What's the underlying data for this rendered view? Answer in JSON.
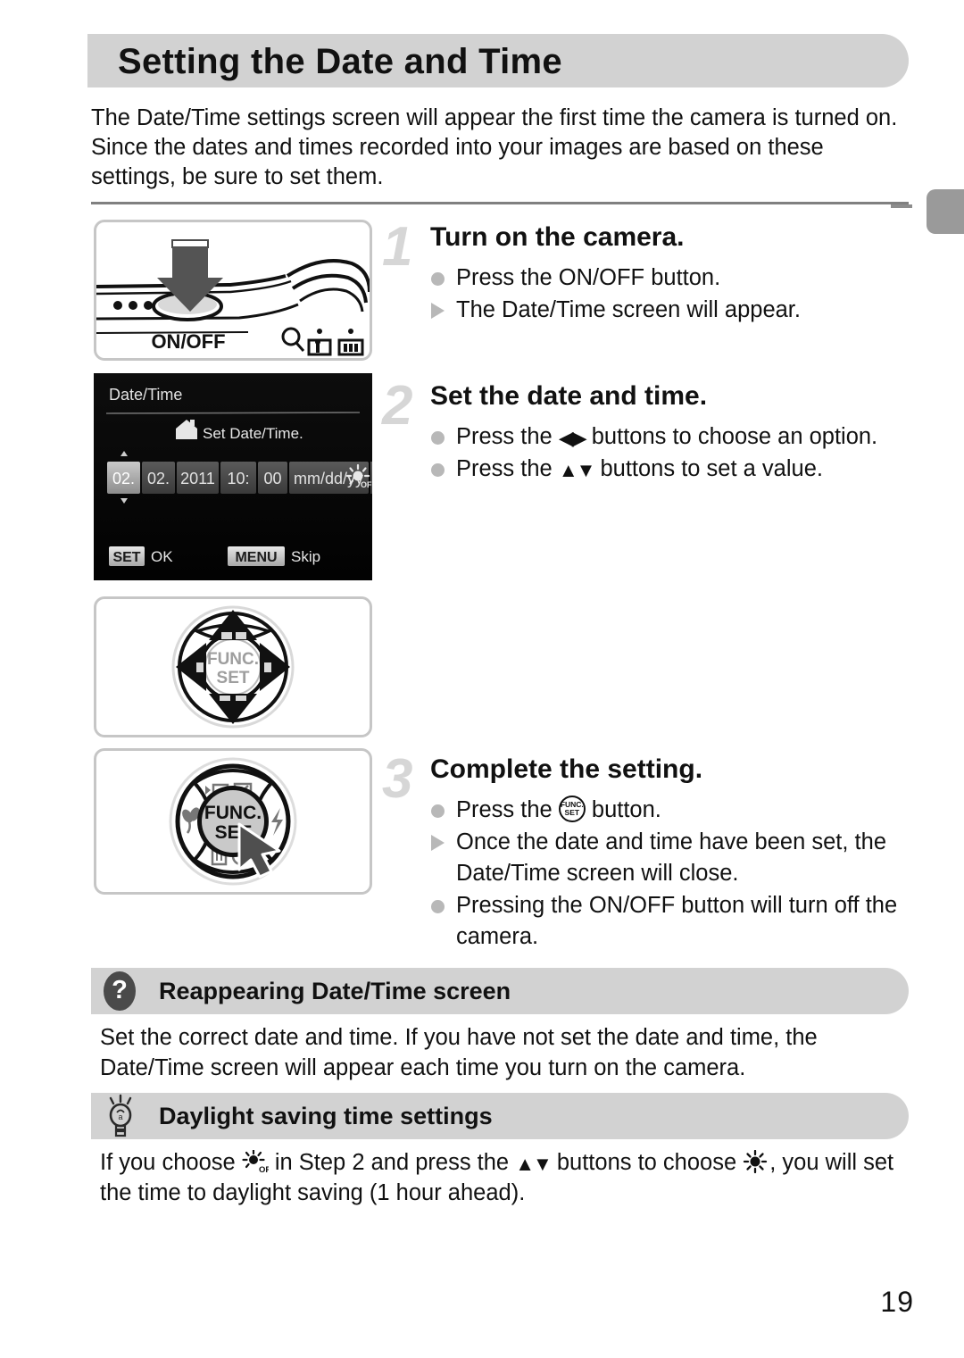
{
  "page": {
    "title": "Setting the Date and Time",
    "intro": "The Date/Time settings screen will appear the first time the camera is turned on. Since the dates and times recorded into your images are based on these settings, be sure to set them.",
    "page_number": "19",
    "banner_color": "#d2d2d2",
    "step_number_color": "#d6d6d6",
    "bullet_color": "#b8b8b8"
  },
  "steps": [
    {
      "number": "1",
      "heading": "Turn on the camera.",
      "lines": [
        {
          "marker": "dot",
          "text": "Press the ON/OFF button."
        },
        {
          "marker": "triangle",
          "text": "The Date/Time screen will appear."
        }
      ]
    },
    {
      "number": "2",
      "heading": "Set the date and time.",
      "lines": [
        {
          "marker": "dot",
          "pre": "Press the ",
          "glyph": "left-right-arrows",
          "post": " buttons to choose an option."
        },
        {
          "marker": "dot",
          "pre": "Press the ",
          "glyph": "up-down-arrows",
          "post": " buttons to set a value."
        }
      ]
    },
    {
      "number": "3",
      "heading": "Complete the setting.",
      "lines": [
        {
          "marker": "dot",
          "pre": "Press the ",
          "glyph": "func-set-button",
          "post": " button."
        },
        {
          "marker": "triangle",
          "text": "Once the date and time have been set, the Date/Time screen will close."
        },
        {
          "marker": "dot",
          "text": "Pressing the ON/OFF button will turn off the camera."
        }
      ]
    }
  ],
  "figures": {
    "camera_top": {
      "button_label": "ON/OFF",
      "zoom_icon_label": "zoom-lever",
      "tele_icon_label": "tele-zoom-icon",
      "wide_icon_label": "wide-zoom-icon"
    },
    "lcd": {
      "title": "Date/Time",
      "prompt": "Set Date/Time.",
      "fields": [
        {
          "value": "02.",
          "selected": true
        },
        {
          "value": "02.",
          "selected": false
        },
        {
          "value": "2011",
          "selected": false
        },
        {
          "value": "10:",
          "selected": false
        },
        {
          "value": "00",
          "selected": false
        },
        {
          "value": "mm/dd/yy",
          "selected": false
        }
      ],
      "dst_icon": "daylight-saving-off-icon",
      "footer": [
        {
          "badge": "SET",
          "label": "OK"
        },
        {
          "badge": "MENU",
          "label": "Skip"
        }
      ]
    },
    "dial_plain": {
      "center_line1": "FUNC.",
      "center_line2": "SET"
    },
    "dial_pressed": {
      "center_line1": "FUNC.",
      "center_line2": "SET",
      "icons": [
        "display-icon",
        "exposure-comp-icon",
        "macro-icon",
        "flash-icon",
        "delete-icon",
        "self-timer-icon"
      ]
    }
  },
  "notes": [
    {
      "icon": "question-icon",
      "heading": "Reappearing Date/Time screen",
      "body": "Set the correct date and time. If you have not set the date and time, the Date/Time screen will appear each time you turn on the camera."
    },
    {
      "icon": "lightbulb-icon",
      "heading": "Daylight saving time settings",
      "body_pre": "If you choose ",
      "body_mid": " in Step 2 and press the ",
      "body_mid2": " buttons to choose ",
      "body_post": ", you will set the time to daylight saving (1 hour ahead)."
    }
  ]
}
